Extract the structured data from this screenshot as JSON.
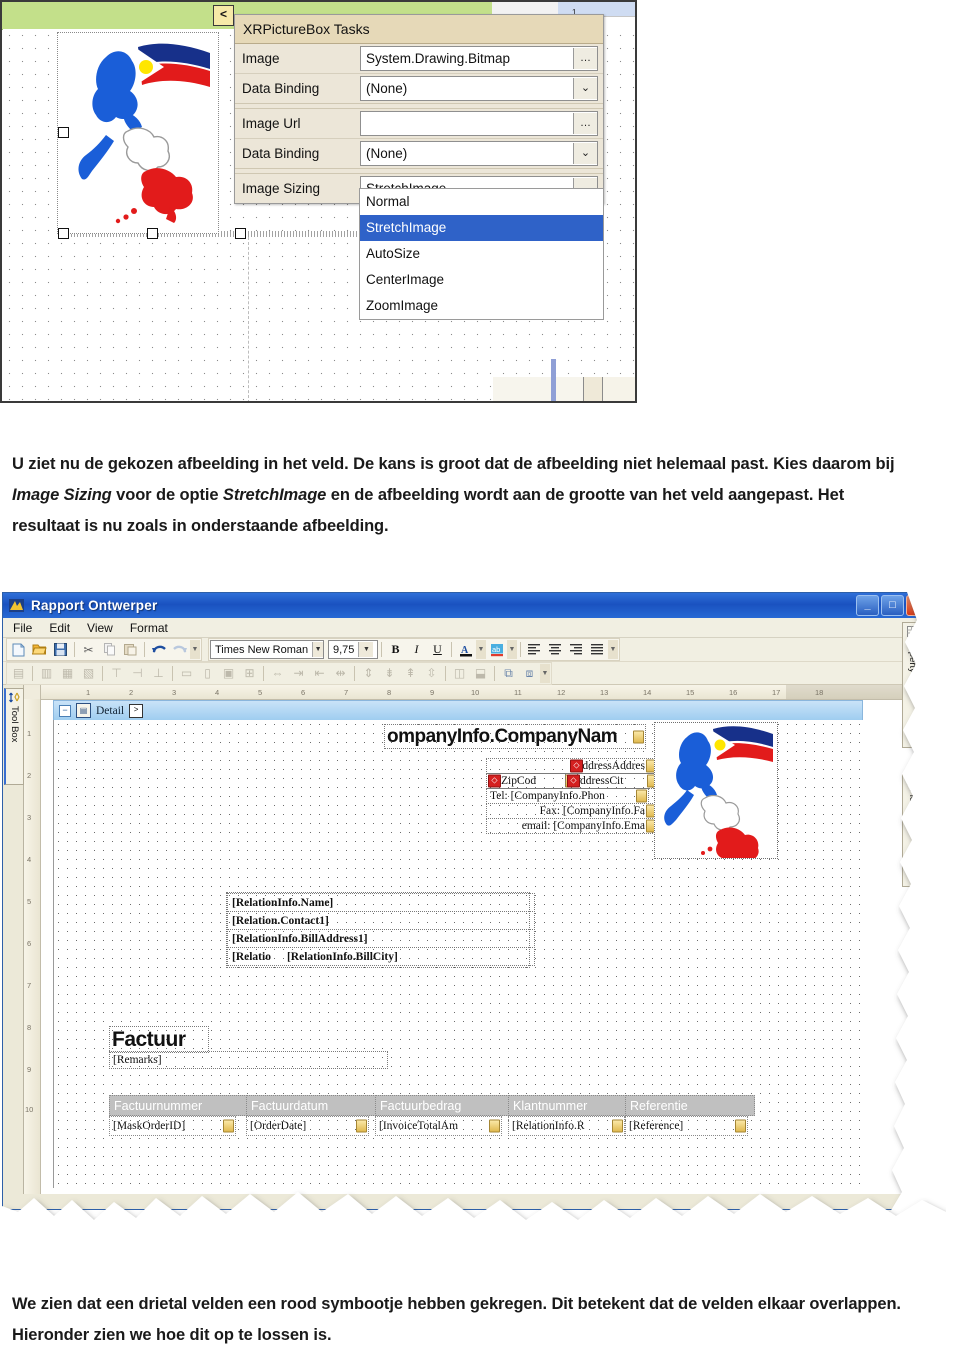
{
  "screenshot1": {
    "popup": {
      "title": "XRPictureBox Tasks",
      "rows": [
        {
          "label": "Image",
          "value": "System.Drawing.Bitmap",
          "button": "…"
        },
        {
          "label": "Data Binding",
          "value": "(None)",
          "button": "v"
        },
        {
          "label": "Image Url",
          "value": "",
          "button": "…"
        },
        {
          "label": "Data Binding",
          "value": "(None)",
          "button": "v"
        },
        {
          "label": "Image Sizing",
          "value": "StretchImage",
          "button": "v"
        }
      ],
      "dropdown_options": [
        "Normal",
        "StretchImage",
        "AutoSize",
        "CenterImage",
        "ZoomImage"
      ],
      "dropdown_selected": "StretchImage",
      "selected_color": "#2f62c8",
      "title_bg": "#e6d9b8"
    },
    "smart_tag_label": "<",
    "top_strip_value": "1"
  },
  "paragraph_top": {
    "part1": "U ziet nu de gekozen afbeelding in het veld. De kans is groot dat de afbeelding niet helemaal past. Kies daarom bij ",
    "em1": "Image Sizing",
    "part2": " voor de optie ",
    "em2": "StretchImage",
    "part3": " en de afbeelding wordt aan de grootte van het veld aangepast. Het resultaat is nu zoals in onderstaande afbeelding."
  },
  "paragraph_bottom": {
    "text": "We zien dat een drietal velden een rood symbootje hebben gekregen. Dit betekent dat de velden elkaar overlappen. Hieronder zien we hoe dit op te lossen is."
  },
  "screenshot2": {
    "window_title": "Rapport Ontwerper",
    "window_buttons": {
      "minimize": "_",
      "maximize": "□",
      "close": "✕"
    },
    "menu": [
      "File",
      "Edit",
      "View",
      "Format"
    ],
    "toolbar": {
      "font_name": "Times New Roman",
      "font_size": "9,75",
      "bold": "B",
      "italic": "I",
      "underline": "U",
      "font_color_icon": "A",
      "highlight_icon": "ab"
    },
    "left_dock_tab": "Tool Box",
    "right_dock_tabs": [
      "Property Grid",
      "Field List"
    ],
    "band": {
      "label": "Detail",
      "smart_tag": ">"
    },
    "h_ruler_ticks": [
      "1",
      "2",
      "3",
      "4",
      "5",
      "6",
      "7",
      "8",
      "9",
      "10",
      "11",
      "12",
      "13",
      "14",
      "15",
      "16",
      "17",
      "18"
    ],
    "v_ruler_ticks": [
      "1",
      "2",
      "3",
      "4",
      "5",
      "6",
      "7",
      "8",
      "9",
      "10"
    ],
    "fields": {
      "company_name": "ompanyInfo.CompanyNam",
      "address": "ddressAddres",
      "zipcode": "ZipCod",
      "city": "ddressCit",
      "tel": "Tel: [CompanyInfo.Phon",
      "fax": "Fax: [CompanyInfo.Fa",
      "email": "email: [CompanyInfo.Ema",
      "relation": [
        "[RelationInfo.Name]",
        "[Relation.Contact1]",
        "[RelationInfo.BillAddress1]",
        "[Relatio"
      ],
      "relation_last_extra": "[RelationInfo.BillCity]",
      "invoice_title": "Factuur",
      "remarks": "[Remarks]"
    },
    "table": {
      "headers": [
        "Factuurnummer",
        "Factuurdatum",
        "Factuurbedrag",
        "Klantnummer",
        "Referentie"
      ],
      "header_bg": "#c0c0c0",
      "values": [
        "[MaskOrderID]",
        "[OrderDate]",
        "[InvoiceTotalAm",
        "[RelationInfo.R",
        "[Reference]"
      ]
    }
  }
}
